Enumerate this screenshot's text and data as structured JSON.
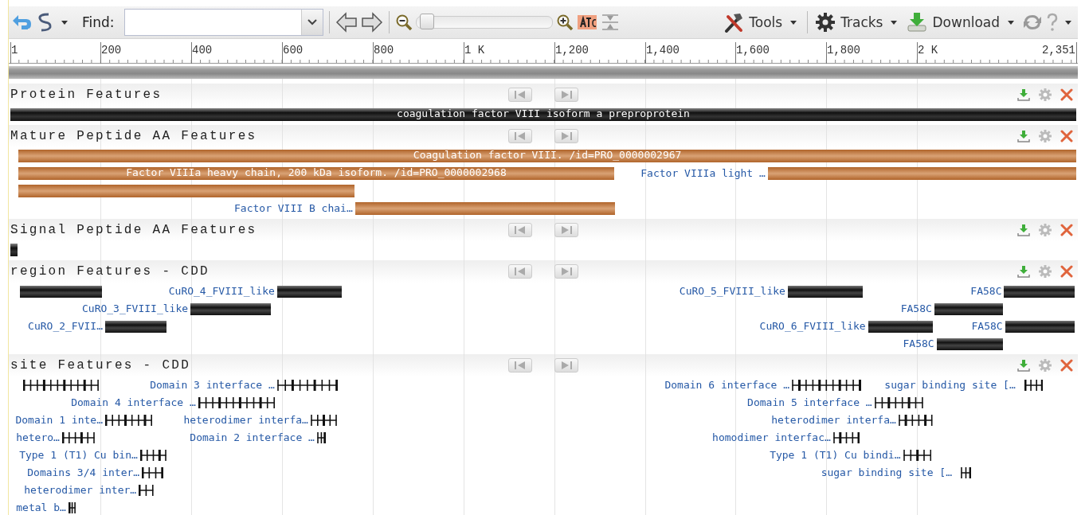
{
  "toolbar": {
    "find_label": "Find:",
    "zoom": {
      "level": 0.03
    },
    "menus": [
      {
        "label": "Tools"
      },
      {
        "label": "Tracks"
      },
      {
        "label": "Download"
      }
    ]
  },
  "ruler": {
    "ticks": [
      {
        "label": "1"
      },
      {
        "label": "200"
      },
      {
        "label": "400"
      },
      {
        "label": "600"
      },
      {
        "label": "800"
      },
      {
        "label": "1 K"
      },
      {
        "label": "1,200"
      },
      {
        "label": "1,400"
      },
      {
        "label": "1,600"
      },
      {
        "label": "1,800"
      },
      {
        "label": "2 K"
      },
      {
        "label": "2,351"
      }
    ]
  },
  "tracks": [
    {
      "title": "Protein Features",
      "kind": "protein",
      "rows": [
        {
          "features": [
            {
              "kind": "inner",
              "label": "coagulation factor VIII isoform a preproprotein"
            }
          ]
        }
      ]
    },
    {
      "title": "Mature Peptide AA Features",
      "kind": "peptide",
      "rows": [
        {
          "features": [
            {
              "kind": "inner",
              "label": "Coagulation factor VIII. /id=PRO_0000002967"
            }
          ]
        },
        {
          "features": [
            {
              "kind": "inner",
              "label": "Factor VIIIa heavy chain, 200 kDa isoform. /id=PRO_0000002968"
            },
            {
              "kind": "outer",
              "label": "Factor VIIIa light …"
            }
          ]
        },
        {
          "features": [
            {
              "kind": "plain"
            }
          ]
        },
        {
          "features": [
            {
              "kind": "outer",
              "label": "Factor VIII B chai…"
            }
          ]
        }
      ]
    },
    {
      "title": "Signal Peptide AA Features",
      "kind": "protein",
      "rows": [
        {
          "features": [
            {
              "kind": "plain"
            }
          ]
        }
      ]
    },
    {
      "title": "region Features - CDD",
      "kind": "region",
      "rows": [
        {
          "features": [
            {
              "kind": "plain"
            },
            {
              "kind": "outer",
              "label": "CuRO_4_FVIII_like"
            },
            {
              "kind": "outer",
              "label": "CuRO_5_FVIII_like"
            },
            {
              "kind": "outer",
              "label": "FA58C"
            }
          ]
        },
        {
          "features": [
            {
              "kind": "outer",
              "label": "CuRO_3_FVIII_like"
            },
            {
              "kind": "outer",
              "label": "FA58C"
            }
          ]
        },
        {
          "features": [
            {
              "kind": "outer",
              "label": "CuRO_2_FVII…"
            },
            {
              "kind": "outer",
              "label": "CuRO_6_FVIII_like"
            },
            {
              "kind": "outer",
              "label": "FA58C"
            }
          ]
        },
        {
          "features": [
            {
              "kind": "outer",
              "label": "FA58C"
            }
          ]
        }
      ]
    },
    {
      "title": "site Features - CDD",
      "kind": "site",
      "rows": [
        {
          "features": [
            {
              "kind": "plain"
            },
            {
              "kind": "outer",
              "label": "Domain 3 interface …"
            },
            {
              "kind": "outer",
              "label": "Domain 6 interface …"
            },
            {
              "kind": "outer",
              "label": "sugar binding site [… "
            }
          ]
        },
        {
          "features": [
            {
              "kind": "outer",
              "label": "Domain 4 interface …"
            },
            {
              "kind": "outer",
              "label": "Domain 5 interface …"
            }
          ]
        },
        {
          "features": [
            {
              "kind": "outer",
              "label": "Domain 1 inte…"
            },
            {
              "kind": "outer",
              "label": "heterodimer interfa…"
            },
            {
              "kind": "outer",
              "label": "heterodimer interfa…"
            }
          ]
        },
        {
          "features": [
            {
              "kind": "outer",
              "label": "hetero…"
            },
            {
              "kind": "outer",
              "label": "Domain 2 interface …"
            },
            {
              "kind": "outer",
              "label": "homodimer interfac…"
            }
          ]
        },
        {
          "features": [
            {
              "kind": "outer",
              "label": "Type 1 (T1) Cu bin…"
            },
            {
              "kind": "outer",
              "label": "Type 1 (T1) Cu bindi…"
            }
          ]
        },
        {
          "features": [
            {
              "kind": "outer",
              "label": "Domains 3/4 inter…"
            },
            {
              "kind": "outer",
              "label": "sugar binding site [… "
            }
          ]
        },
        {
          "features": [
            {
              "kind": "outer",
              "label": "heterodimer inter…"
            }
          ]
        },
        {
          "features": [
            {
              "kind": "outer",
              "label": "metal b…"
            }
          ]
        }
      ]
    }
  ]
}
